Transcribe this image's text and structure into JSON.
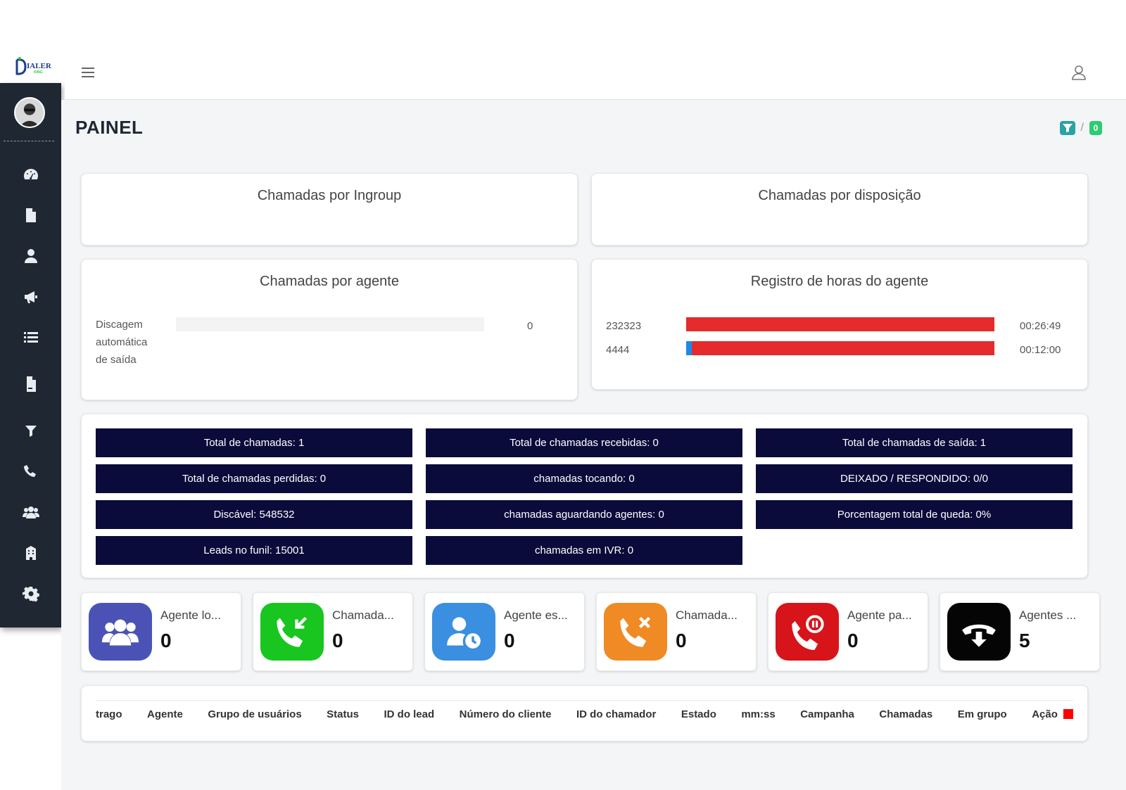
{
  "logo": {
    "text_main": "IALER",
    "text_sub": "KING"
  },
  "sidebar": {
    "items": [
      {
        "icon": "dashboard-icon"
      },
      {
        "icon": "document-icon"
      },
      {
        "icon": "user-icon"
      },
      {
        "icon": "megaphone-icon"
      },
      {
        "icon": "list-icon"
      },
      {
        "icon": "report-file-icon"
      },
      {
        "icon": "filter-icon"
      },
      {
        "icon": "phone-icon"
      },
      {
        "icon": "users-group-icon"
      },
      {
        "icon": "building-icon"
      },
      {
        "icon": "gear-icon"
      }
    ]
  },
  "header": {
    "title": "PAINEL",
    "crumb_separator": "/",
    "badge_count": "0"
  },
  "cards": {
    "ingroup_title": "Chamadas por Ingroup",
    "disposition_title": "Chamadas por disposição",
    "agent_title": "Chamadas por agente",
    "hours_title": "Registro de horas do agente"
  },
  "agent_calls": {
    "rows": [
      {
        "label_lines": [
          "Discagem",
          "automática",
          "de saída"
        ],
        "value": 0,
        "display": "0"
      }
    ],
    "max": 1
  },
  "agent_hours": {
    "fill_color": "#e52b2b",
    "accent_color": "#1e88e5",
    "rows": [
      {
        "agent": "232323",
        "time": "00:26:49",
        "fraction": 1.0,
        "accent_fraction": 0.0
      },
      {
        "agent": "4444",
        "time": "00:12:00",
        "fraction": 1.0,
        "accent_fraction": 0.018
      }
    ]
  },
  "stats": [
    "Total de chamadas: 1",
    "Total de chamadas recebidas: 0",
    "Total de chamadas de saída: 1",
    "Total de chamadas perdidas: 0",
    "chamadas tocando: 0",
    "DEIXADO / RESPONDIDO: 0/0",
    "Discável: 548532",
    "chamadas aguardando agentes: 0",
    "Porcentagem total de queda: 0%",
    "Leads no funil: 15001",
    "chamadas em IVR: 0"
  ],
  "status_cards": [
    {
      "label": "Agente lo...",
      "count": "0",
      "color": "#4a53b5",
      "icon": "users-group-icon"
    },
    {
      "label": "Chamada...",
      "count": "0",
      "color": "#18c61f",
      "icon": "incoming-call-icon"
    },
    {
      "label": "Agente es...",
      "count": "0",
      "color": "#3a8fe0",
      "icon": "user-clock-icon"
    },
    {
      "label": "Chamada...",
      "count": "0",
      "color": "#f08a24",
      "icon": "missed-call-icon"
    },
    {
      "label": "Agente pa...",
      "count": "0",
      "color": "#d7141a",
      "icon": "paused-call-icon"
    },
    {
      "label": "Agentes ...",
      "count": "5",
      "color": "#050505",
      "icon": "hangup-icon"
    }
  ],
  "table": {
    "headers": [
      "trago",
      "Agente",
      "Grupo de usuários",
      "Status",
      "ID do lead",
      "Número do cliente",
      "ID do chamador",
      "Estado",
      "mm:ss",
      "Campanha",
      "Chamadas",
      "Em grupo",
      "Ação"
    ]
  }
}
